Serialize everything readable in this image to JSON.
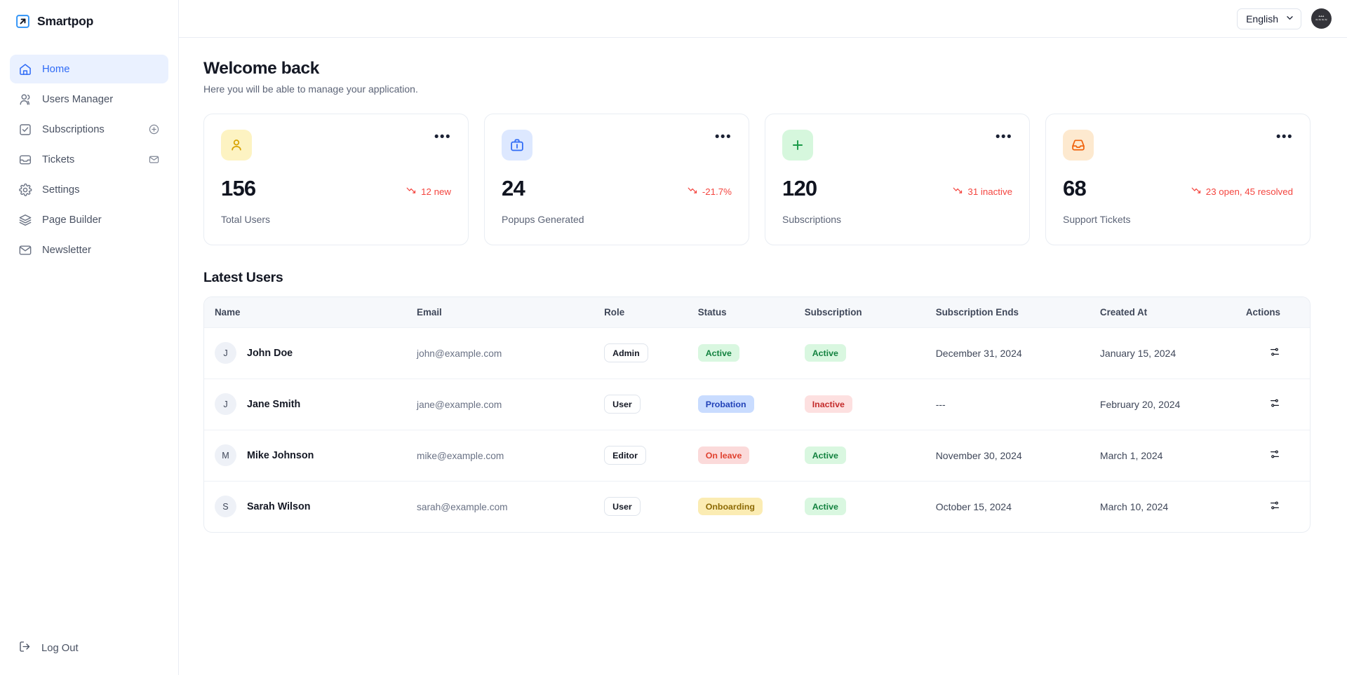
{
  "brand": {
    "name": "Smartpop",
    "logo_icon": "arrow-up-right-square-icon"
  },
  "sidebar": {
    "items": [
      {
        "label": "Home",
        "icon": "home-icon",
        "active": true,
        "trailing": null
      },
      {
        "label": "Users Manager",
        "icon": "users-icon",
        "active": false,
        "trailing": null
      },
      {
        "label": "Subscriptions",
        "icon": "check-square-icon",
        "active": false,
        "trailing": "plus-circle-icon"
      },
      {
        "label": "Tickets",
        "icon": "inbox-icon",
        "active": false,
        "trailing": "mail-icon"
      },
      {
        "label": "Settings",
        "icon": "gear-icon",
        "active": false,
        "trailing": null
      },
      {
        "label": "Page Builder",
        "icon": "layers-icon",
        "active": false,
        "trailing": null
      },
      {
        "label": "Newsletter",
        "icon": "envelope-icon",
        "active": false,
        "trailing": null
      }
    ],
    "logout": {
      "label": "Log Out",
      "icon": "logout-icon"
    }
  },
  "topbar": {
    "language": {
      "value": "English",
      "chevron_icon": "chevron-down-icon"
    },
    "avatar": {
      "name": "avatar",
      "initials": ""
    }
  },
  "header": {
    "title": "Welcome back",
    "subtitle": "Here you will be able to manage your application."
  },
  "cards": [
    {
      "icon": "person-icon",
      "icon_bg": "#fdf3c2",
      "icon_color": "#d8a303",
      "value": "156",
      "delta": "12 new",
      "delta_color": "#f4453f",
      "label": "Total Users",
      "menu_icon": "ellipsis-icon"
    },
    {
      "icon": "briefcase-icon",
      "icon_bg": "#dde8ff",
      "icon_color": "#2f6bf6",
      "value": "24",
      "delta": "-21.7%",
      "delta_color": "#f4453f",
      "label": "Popups Generated",
      "menu_icon": "ellipsis-icon"
    },
    {
      "icon": "plus-icon",
      "icon_bg": "#d6f7dd",
      "icon_color": "#1a9a48",
      "value": "120",
      "delta": "31 inactive",
      "delta_color": "#f4453f",
      "label": "Subscriptions",
      "menu_icon": "ellipsis-icon"
    },
    {
      "icon": "inbox-icon",
      "icon_bg": "#fde9cf",
      "icon_color": "#f0620c",
      "value": "68",
      "delta": "23 open, 45 resolved",
      "delta_color": "#f4453f",
      "label": "Support Tickets",
      "menu_icon": "ellipsis-icon"
    }
  ],
  "table": {
    "title": "Latest Users",
    "columns": [
      "Name",
      "Email",
      "Role",
      "Status",
      "Subscription",
      "Subscription Ends",
      "Created At",
      "Actions"
    ],
    "rows": [
      {
        "initial": "J",
        "name": "John Doe",
        "email": "john@example.com",
        "role": "Admin",
        "status": "Active",
        "status_style": "pill-green",
        "subscription": "Active",
        "subscription_style": "pill-green",
        "subscription_ends": "December 31, 2024",
        "created_at": "January 15, 2024",
        "action_icon": "settings-sliders-icon"
      },
      {
        "initial": "J",
        "name": "Jane Smith",
        "email": "jane@example.com",
        "role": "User",
        "status": "Probation",
        "status_style": "pill-blue",
        "subscription": "Inactive",
        "subscription_style": "pill-pinkred",
        "subscription_ends": "---",
        "created_at": "February 20, 2024",
        "action_icon": "settings-sliders-icon"
      },
      {
        "initial": "M",
        "name": "Mike Johnson",
        "email": "mike@example.com",
        "role": "Editor",
        "status": "On leave",
        "status_style": "pill-redsoft",
        "subscription": "Active",
        "subscription_style": "pill-green",
        "subscription_ends": "November 30, 2024",
        "created_at": "March 1, 2024",
        "action_icon": "settings-sliders-icon"
      },
      {
        "initial": "S",
        "name": "Sarah Wilson",
        "email": "sarah@example.com",
        "role": "User",
        "status": "Onboarding",
        "status_style": "pill-yellow",
        "subscription": "Active",
        "subscription_style": "pill-green",
        "subscription_ends": "October 15, 2024",
        "created_at": "March 10, 2024",
        "action_icon": "settings-sliders-icon"
      }
    ]
  }
}
